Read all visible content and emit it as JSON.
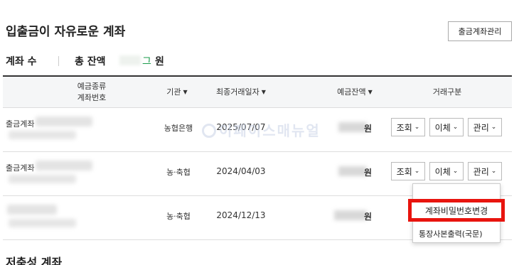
{
  "section": {
    "title": "입출금이 자유로운 계좌",
    "manage_button": "출금계좌관리"
  },
  "summary": {
    "count_label": "계좌 수",
    "balance_label": "총 잔액",
    "balance_tail": "그",
    "currency": "원"
  },
  "table": {
    "headers": {
      "type_line1": "예금종류",
      "type_line2": "계좌번호",
      "bank": "기관",
      "last_date": "최종거래일자",
      "balance": "예금잔액",
      "actions": "거래구분"
    },
    "caret": "▼",
    "rows": [
      {
        "name": "출금계좌",
        "bank": "농협은행",
        "date": "2025/07/07",
        "currency": "원"
      },
      {
        "name": "출금계좌",
        "bank": "농·축협",
        "date": "2024/04/03",
        "currency": "원"
      },
      {
        "name": "",
        "bank": "농·축협",
        "date": "2024/12/13",
        "currency": "원"
      }
    ],
    "buttons": {
      "view": "조회",
      "transfer": "이체",
      "manage": "관리"
    },
    "chevron": "⌄"
  },
  "watermark": {
    "text": "이페이스매뉴얼"
  },
  "dropdown": {
    "items": [
      "계좌비밀번호변경",
      "통장사본출력(국문)"
    ],
    "highlighted": "계좌비밀번호변경"
  },
  "next_section": {
    "title": "저축성 계좌"
  },
  "colors": {
    "highlight_border": "#e8140e",
    "accent_green": "#1a9a4a"
  }
}
